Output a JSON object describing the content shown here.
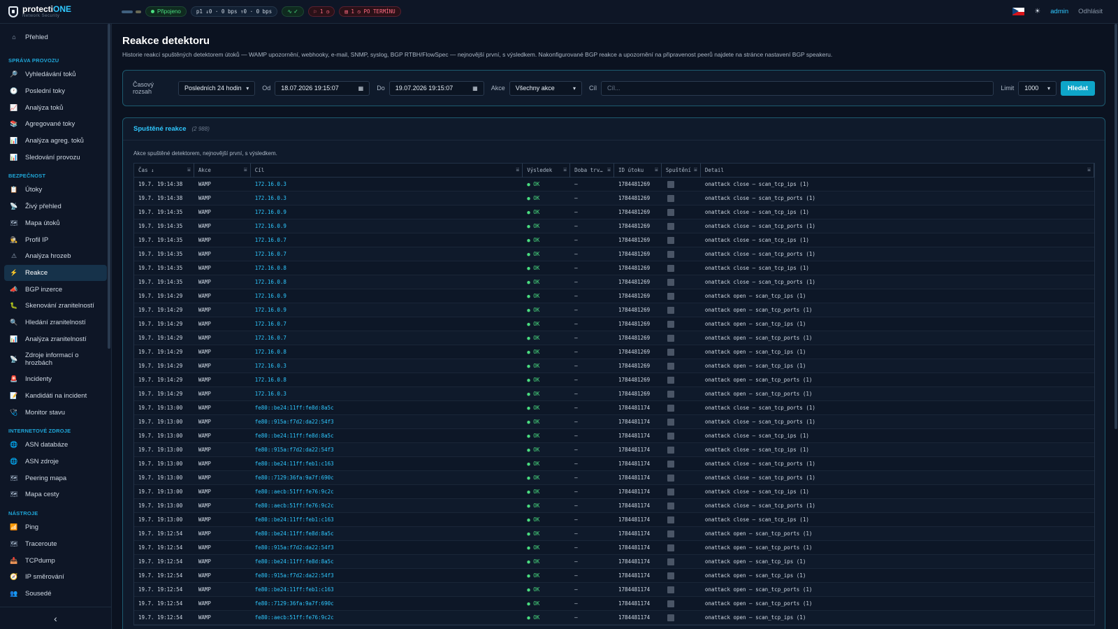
{
  "brand": {
    "name_a": "protecti",
    "name_b": "ONE",
    "sub": "Network Security"
  },
  "topbar": {
    "connected": "Připojeno",
    "traffic": "p1 ↓0 · 0 bps ↑0 · 0 bps",
    "health": "∿ ✓",
    "flag_count": "⚐ 1 ◷",
    "overdue": "▤ 1 ◷ PO TERMÍNU",
    "user": "admin",
    "logout": "Odhlásit"
  },
  "sidebar": {
    "overview": "Přehled",
    "sections": [
      {
        "title": "SPRÁVA PROVOZU",
        "items": [
          {
            "label": "Vyhledávání toků",
            "icon": "search-icon",
            "glyph": "🔎"
          },
          {
            "label": "Poslední toky",
            "icon": "clock-icon",
            "glyph": "🕐"
          },
          {
            "label": "Analýza toků",
            "icon": "chart-icon",
            "glyph": "📈"
          },
          {
            "label": "Agregované toky",
            "icon": "stack-icon",
            "glyph": "📚"
          },
          {
            "label": "Analýza agreg. toků",
            "icon": "bar-chart-icon",
            "glyph": "📊"
          },
          {
            "label": "Sledování provozu",
            "icon": "bar-chart-icon",
            "glyph": "📊"
          }
        ]
      },
      {
        "title": "BEZPEČNOST",
        "items": [
          {
            "label": "Útoky",
            "icon": "clipboard-icon",
            "glyph": "📋"
          },
          {
            "label": "Živý přehled",
            "icon": "satellite-icon",
            "glyph": "📡"
          },
          {
            "label": "Mapa útoků",
            "icon": "map-icon",
            "glyph": "🗺"
          },
          {
            "label": "Profil IP",
            "icon": "detective-icon",
            "glyph": "🕵"
          },
          {
            "label": "Analýza hrozeb",
            "icon": "warning-icon",
            "glyph": "⚠"
          },
          {
            "label": "Reakce",
            "icon": "lightning-icon",
            "glyph": "⚡",
            "active": true
          },
          {
            "label": "BGP inzerce",
            "icon": "megaphone-icon",
            "glyph": "📣"
          },
          {
            "label": "Skenování zranitelností",
            "icon": "bug-icon",
            "glyph": "🐛"
          },
          {
            "label": "Hledání zranitelností",
            "icon": "magnifier-icon",
            "glyph": "🔍"
          },
          {
            "label": "Analýza zranitelností",
            "icon": "bar-chart-icon",
            "glyph": "📊"
          },
          {
            "label": "Zdroje informací o hrozbách",
            "icon": "satellite-icon",
            "glyph": "📡",
            "tall": true
          },
          {
            "label": "Incidenty",
            "icon": "siren-icon",
            "glyph": "🚨"
          },
          {
            "label": "Kandidáti na incident",
            "icon": "memo-icon",
            "glyph": "📝"
          },
          {
            "label": "Monitor stavu",
            "icon": "stethoscope-icon",
            "glyph": "🩺"
          }
        ]
      },
      {
        "title": "INTERNETOVÉ ZDROJE",
        "items": [
          {
            "label": "ASN databáze",
            "icon": "globe-icon",
            "glyph": "🌐"
          },
          {
            "label": "ASN zdroje",
            "icon": "globe-icon",
            "glyph": "🌐"
          },
          {
            "label": "Peering mapa",
            "icon": "map-icon",
            "glyph": "🗺"
          },
          {
            "label": "Mapa cesty",
            "icon": "map-icon",
            "glyph": "🗺"
          }
        ]
      },
      {
        "title": "NÁSTROJE",
        "items": [
          {
            "label": "Ping",
            "icon": "signal-icon",
            "glyph": "📶"
          },
          {
            "label": "Traceroute",
            "icon": "map-icon",
            "glyph": "🗺"
          },
          {
            "label": "TCPdump",
            "icon": "inbox-icon",
            "glyph": "📥"
          },
          {
            "label": "IP směrování",
            "icon": "compass-icon",
            "glyph": "🧭"
          },
          {
            "label": "Sousedé",
            "icon": "people-icon",
            "glyph": "👥"
          }
        ]
      }
    ],
    "collapse": "‹"
  },
  "page": {
    "title": "Reakce detektoru",
    "subtitle": "Historie reakcí spuštěných detektorem útoků — WAMP upozornění, webhooky, e-mail, SNMP, syslog, BGP RTBH/FlowSpec — nejnovější první, s výsledkem. Nakonfigurované BGP reakce a upozornění na připravenost peerů najdete na stránce nastavení BGP speakeru."
  },
  "filters": {
    "range_label": "Časový rozsah",
    "range_value": "Posledních 24 hodin",
    "from_label": "Od",
    "from_value": "18.07.2026 19:15:07",
    "to_label": "Do",
    "to_value": "19.07.2026 19:15:07",
    "action_label": "Akce",
    "action_value": "Všechny akce",
    "target_label": "Cíl",
    "target_placeholder": "Cíl...",
    "limit_label": "Limit",
    "limit_value": "1000",
    "search_button": "Hledat"
  },
  "table": {
    "title": "Spuštěné reakce",
    "count": "(2 988)",
    "description": "Akce spuštěné detektorem, nejnovější první, s výsledkem.",
    "columns": [
      "Čas ↓",
      "Akce",
      "Cíl",
      "Výsledek",
      "Doba trv…",
      "ID útoku",
      "Spuštění",
      "Detail"
    ],
    "rows": [
      [
        "19.7. 19:14:38",
        "WAMP",
        "172.16.0.3",
        "● OK",
        "—",
        "1784481269",
        "onattack close — scan_tcp_ips (1)"
      ],
      [
        "19.7. 19:14:38",
        "WAMP",
        "172.16.0.3",
        "● OK",
        "—",
        "1784481269",
        "onattack close — scan_tcp_ports (1)"
      ],
      [
        "19.7. 19:14:35",
        "WAMP",
        "172.16.0.9",
        "● OK",
        "—",
        "1784481269",
        "onattack close — scan_tcp_ips (1)"
      ],
      [
        "19.7. 19:14:35",
        "WAMP",
        "172.16.0.9",
        "● OK",
        "—",
        "1784481269",
        "onattack close — scan_tcp_ports (1)"
      ],
      [
        "19.7. 19:14:35",
        "WAMP",
        "172.16.0.7",
        "● OK",
        "—",
        "1784481269",
        "onattack close — scan_tcp_ips (1)"
      ],
      [
        "19.7. 19:14:35",
        "WAMP",
        "172.16.0.7",
        "● OK",
        "—",
        "1784481269",
        "onattack close — scan_tcp_ports (1)"
      ],
      [
        "19.7. 19:14:35",
        "WAMP",
        "172.16.0.8",
        "● OK",
        "—",
        "1784481269",
        "onattack close — scan_tcp_ips (1)"
      ],
      [
        "19.7. 19:14:35",
        "WAMP",
        "172.16.0.8",
        "● OK",
        "—",
        "1784481269",
        "onattack close — scan_tcp_ports (1)"
      ],
      [
        "19.7. 19:14:29",
        "WAMP",
        "172.16.0.9",
        "● OK",
        "—",
        "1784481269",
        "onattack open — scan_tcp_ips (1)"
      ],
      [
        "19.7. 19:14:29",
        "WAMP",
        "172.16.0.9",
        "● OK",
        "—",
        "1784481269",
        "onattack open — scan_tcp_ports (1)"
      ],
      [
        "19.7. 19:14:29",
        "WAMP",
        "172.16.0.7",
        "● OK",
        "—",
        "1784481269",
        "onattack open — scan_tcp_ips (1)"
      ],
      [
        "19.7. 19:14:29",
        "WAMP",
        "172.16.0.7",
        "● OK",
        "—",
        "1784481269",
        "onattack open — scan_tcp_ports (1)"
      ],
      [
        "19.7. 19:14:29",
        "WAMP",
        "172.16.0.8",
        "● OK",
        "—",
        "1784481269",
        "onattack open — scan_tcp_ips (1)"
      ],
      [
        "19.7. 19:14:29",
        "WAMP",
        "172.16.0.3",
        "● OK",
        "—",
        "1784481269",
        "onattack open — scan_tcp_ips (1)"
      ],
      [
        "19.7. 19:14:29",
        "WAMP",
        "172.16.0.8",
        "● OK",
        "—",
        "1784481269",
        "onattack open — scan_tcp_ports (1)"
      ],
      [
        "19.7. 19:14:29",
        "WAMP",
        "172.16.0.3",
        "● OK",
        "—",
        "1784481269",
        "onattack open — scan_tcp_ports (1)"
      ],
      [
        "19.7. 19:13:00",
        "WAMP",
        "fe80::be24:11ff:fe8d:8a5c",
        "● OK",
        "—",
        "1784481174",
        "onattack close — scan_tcp_ports (1)"
      ],
      [
        "19.7. 19:13:00",
        "WAMP",
        "fe80::915a:f7d2:da22:54f3",
        "● OK",
        "—",
        "1784481174",
        "onattack close — scan_tcp_ports (1)"
      ],
      [
        "19.7. 19:13:00",
        "WAMP",
        "fe80::be24:11ff:fe8d:8a5c",
        "● OK",
        "—",
        "1784481174",
        "onattack close — scan_tcp_ips (1)"
      ],
      [
        "19.7. 19:13:00",
        "WAMP",
        "fe80::915a:f7d2:da22:54f3",
        "● OK",
        "—",
        "1784481174",
        "onattack close — scan_tcp_ips (1)"
      ],
      [
        "19.7. 19:13:00",
        "WAMP",
        "fe80::be24:11ff:feb1:c163",
        "● OK",
        "—",
        "1784481174",
        "onattack close — scan_tcp_ports (1)"
      ],
      [
        "19.7. 19:13:00",
        "WAMP",
        "fe80::7129:36fa:9a7f:690c",
        "● OK",
        "—",
        "1784481174",
        "onattack close — scan_tcp_ports (1)"
      ],
      [
        "19.7. 19:13:00",
        "WAMP",
        "fe80::aecb:51ff:fe76:9c2c",
        "● OK",
        "—",
        "1784481174",
        "onattack close — scan_tcp_ips (1)"
      ],
      [
        "19.7. 19:13:00",
        "WAMP",
        "fe80::aecb:51ff:fe76:9c2c",
        "● OK",
        "—",
        "1784481174",
        "onattack close — scan_tcp_ports (1)"
      ],
      [
        "19.7. 19:13:00",
        "WAMP",
        "fe80::be24:11ff:feb1:c163",
        "● OK",
        "—",
        "1784481174",
        "onattack close — scan_tcp_ips (1)"
      ],
      [
        "19.7. 19:12:54",
        "WAMP",
        "fe80::be24:11ff:fe8d:8a5c",
        "● OK",
        "—",
        "1784481174",
        "onattack open — scan_tcp_ports (1)"
      ],
      [
        "19.7. 19:12:54",
        "WAMP",
        "fe80::915a:f7d2:da22:54f3",
        "● OK",
        "—",
        "1784481174",
        "onattack open — scan_tcp_ports (1)"
      ],
      [
        "19.7. 19:12:54",
        "WAMP",
        "fe80::be24:11ff:fe8d:8a5c",
        "● OK",
        "—",
        "1784481174",
        "onattack open — scan_tcp_ips (1)"
      ],
      [
        "19.7. 19:12:54",
        "WAMP",
        "fe80::915a:f7d2:da22:54f3",
        "● OK",
        "—",
        "1784481174",
        "onattack open — scan_tcp_ips (1)"
      ],
      [
        "19.7. 19:12:54",
        "WAMP",
        "fe80::be24:11ff:feb1:c163",
        "● OK",
        "—",
        "1784481174",
        "onattack open — scan_tcp_ports (1)"
      ],
      [
        "19.7. 19:12:54",
        "WAMP",
        "fe80::7129:36fa:9a7f:690c",
        "● OK",
        "—",
        "1784481174",
        "onattack open — scan_tcp_ports (1)"
      ],
      [
        "19.7. 19:12:54",
        "WAMP",
        "fe80::aecb:51ff:fe76:9c2c",
        "● OK",
        "—",
        "1784481174",
        "onattack open — scan_tcp_ips (1)"
      ]
    ]
  }
}
